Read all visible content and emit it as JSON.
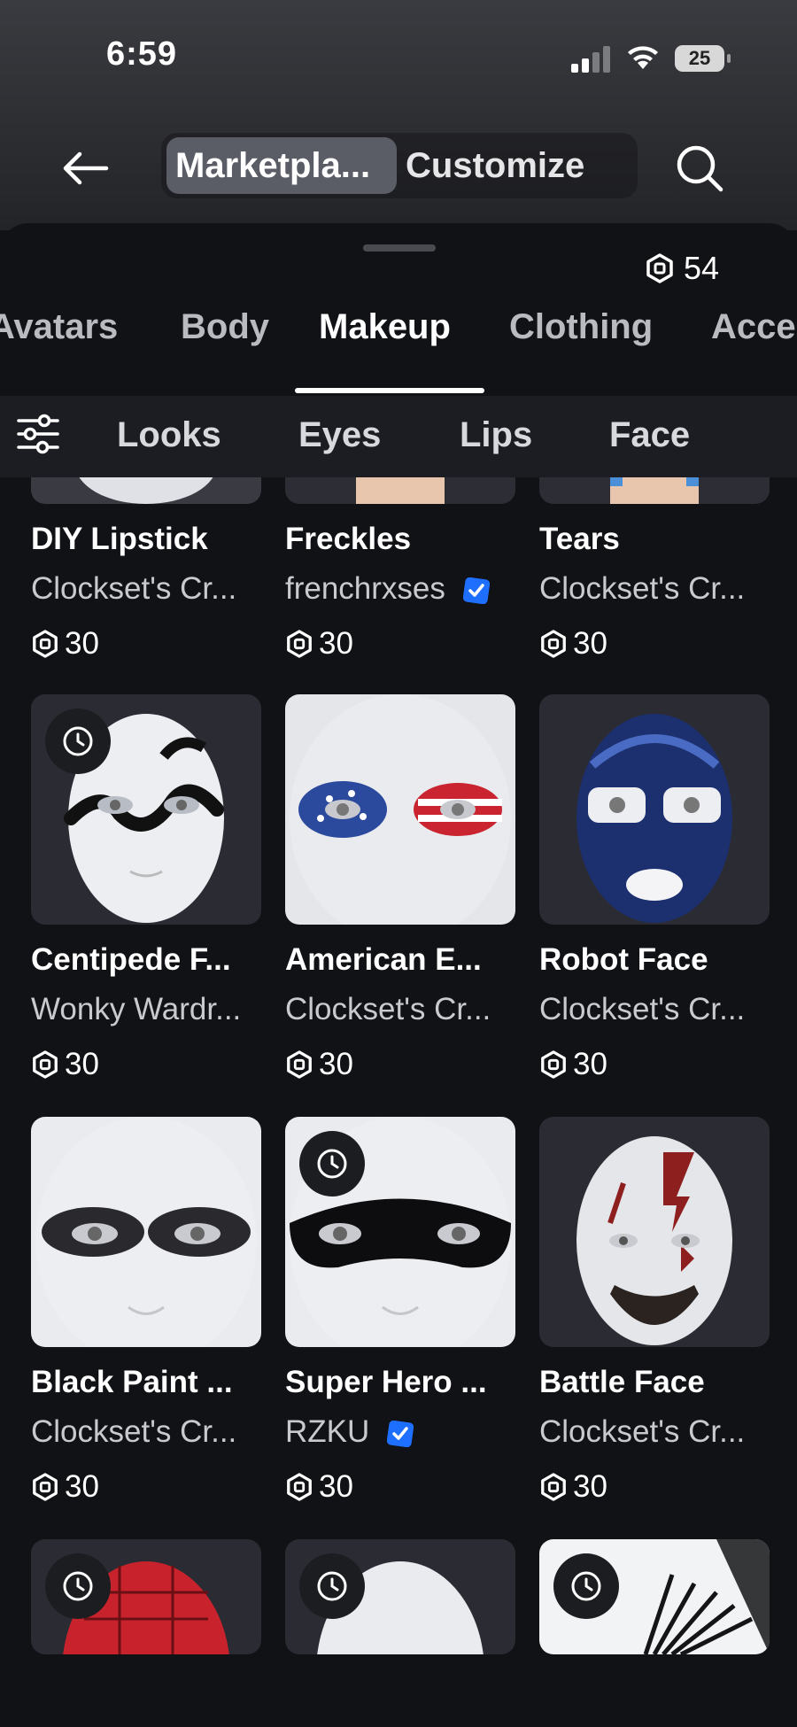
{
  "status": {
    "time": "6:59",
    "battery": "25"
  },
  "topnav": {
    "tab_marketplace": "Marketpla...",
    "tab_customize": "Customize"
  },
  "balance": "54",
  "categories": [
    "Avatars",
    "Body",
    "Makeup",
    "Clothing",
    "Acce"
  ],
  "subcategories": [
    "Looks",
    "Eyes",
    "Lips",
    "Face"
  ],
  "items": [
    {
      "name": "DIY Lipstick",
      "creator": "Clockset's Cr...",
      "price": "30"
    },
    {
      "name": "Freckles",
      "creator": "frenchrxses",
      "price": "30",
      "verified": true
    },
    {
      "name": "Tears",
      "creator": "Clockset's Cr...",
      "price": "30"
    },
    {
      "name": "Centipede F...",
      "creator": "Wonky Wardr...",
      "price": "30",
      "timed": true
    },
    {
      "name": "American E...",
      "creator": "Clockset's Cr...",
      "price": "30"
    },
    {
      "name": "Robot Face",
      "creator": "Clockset's Cr...",
      "price": "30"
    },
    {
      "name": "Black Paint ...",
      "creator": "Clockset's Cr...",
      "price": "30"
    },
    {
      "name": "Super Hero ...",
      "creator": "RZKU",
      "price": "30",
      "verified": true,
      "timed": true
    },
    {
      "name": "Battle Face",
      "creator": "Clockset's Cr...",
      "price": "30"
    }
  ],
  "colors": {
    "background": "#111216",
    "accent_verified": "#1f6fff"
  }
}
